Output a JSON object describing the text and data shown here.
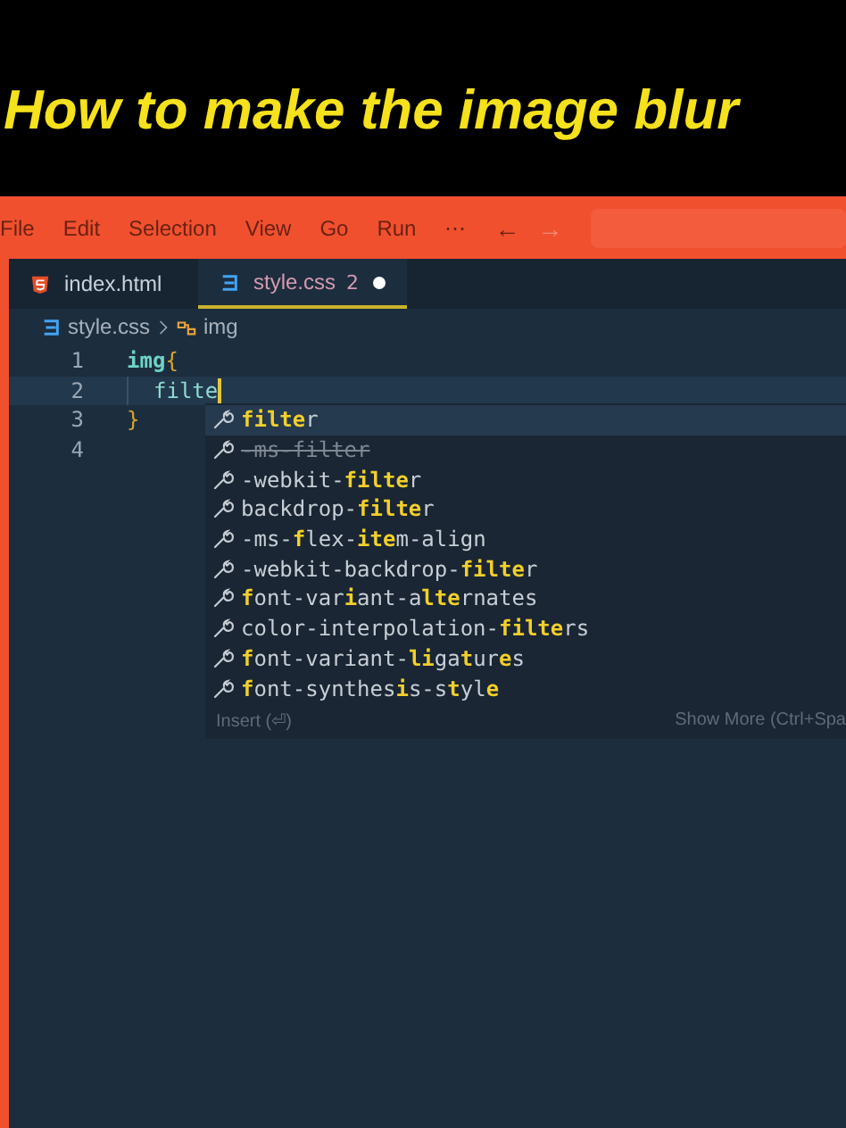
{
  "banner": {
    "title": "How to make the image blur"
  },
  "menu_bar": {
    "items": [
      "File",
      "Edit",
      "Selection",
      "View",
      "Go",
      "Run",
      "⋯"
    ],
    "back": "←",
    "forward": "→"
  },
  "tabs": [
    {
      "label": "index.html",
      "kind": "html",
      "selected": false
    },
    {
      "label": "style.css",
      "kind": "css",
      "selected": true,
      "problems": "2",
      "modified": true
    }
  ],
  "breadcrumbs": {
    "file": "style.css",
    "symbol": "img"
  },
  "editor": {
    "lines": [
      {
        "number": "1",
        "current": false,
        "tokens": [
          {
            "text": "img",
            "kind": "selector"
          },
          {
            "text": "{",
            "kind": "brace"
          }
        ]
      },
      {
        "number": "2",
        "current": true,
        "indent": true,
        "tokens": [
          {
            "text": "filte",
            "kind": "property"
          }
        ]
      },
      {
        "number": "3",
        "current": false,
        "tokens": [
          {
            "text": "}",
            "kind": "brace"
          }
        ]
      },
      {
        "number": "4",
        "current": false
      }
    ]
  },
  "suggestions": {
    "items": [
      {
        "label": "**filte**r",
        "selected": true,
        "deprecated": false
      },
      {
        "label": "-ms-filter",
        "selected": false,
        "deprecated": true
      },
      {
        "label": "-webkit-**filte**r",
        "selected": false,
        "deprecated": false
      },
      {
        "label": "backdrop-**filte**r",
        "selected": false,
        "deprecated": false
      },
      {
        "label": "-ms-**f**lex-**ite**m-align",
        "selected": false,
        "deprecated": false
      },
      {
        "label": "-webkit-backdrop-**filte**r",
        "selected": false,
        "deprecated": false
      },
      {
        "label": "**f**ont-var**i**ant-a**lte**rnates",
        "selected": false,
        "deprecated": false
      },
      {
        "label": "color-interpolation-**filte**rs",
        "selected": false,
        "deprecated": false
      },
      {
        "label": "**f**ont-variant-**li**ga**t**ur**e**s",
        "selected": false,
        "deprecated": false
      },
      {
        "label": "**f**ont-synthes**i**s-s**t**yl**e**",
        "selected": false,
        "deprecated": false
      }
    ],
    "footer_left": "Insert (⏎)",
    "footer_right": "Show More (Ctrl+Spa"
  }
}
